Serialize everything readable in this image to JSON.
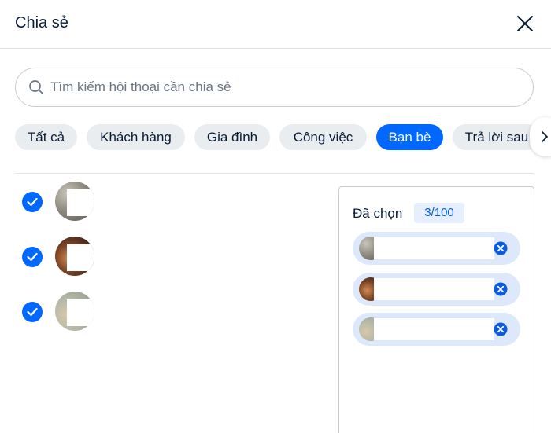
{
  "dialog": {
    "title": "Chia sẻ",
    "close_icon": "close-icon"
  },
  "search": {
    "placeholder": "Tìm kiếm hội thoại cần chia sẻ",
    "value": "",
    "icon": "search-icon"
  },
  "tabs": [
    {
      "label": "Tất cả",
      "active": false
    },
    {
      "label": "Khách hàng",
      "active": false
    },
    {
      "label": "Gia đình",
      "active": false
    },
    {
      "label": "Công việc",
      "active": false
    },
    {
      "label": "Bạn bè",
      "active": true
    },
    {
      "label": "Trả lời sau",
      "active": false
    }
  ],
  "tabs_next_icon": "chevron-right-icon",
  "contacts": [
    {
      "checked": true,
      "name": ""
    },
    {
      "checked": true,
      "name": ""
    },
    {
      "checked": true,
      "name": ""
    }
  ],
  "selected": {
    "title": "Đã chọn",
    "count": "3/100",
    "remove_icon": "remove-circle-icon"
  },
  "colors": {
    "accent": "#0068ff",
    "chip_bg": "#dde9fb",
    "count_bg": "#e5efff",
    "text": "#081c36"
  }
}
